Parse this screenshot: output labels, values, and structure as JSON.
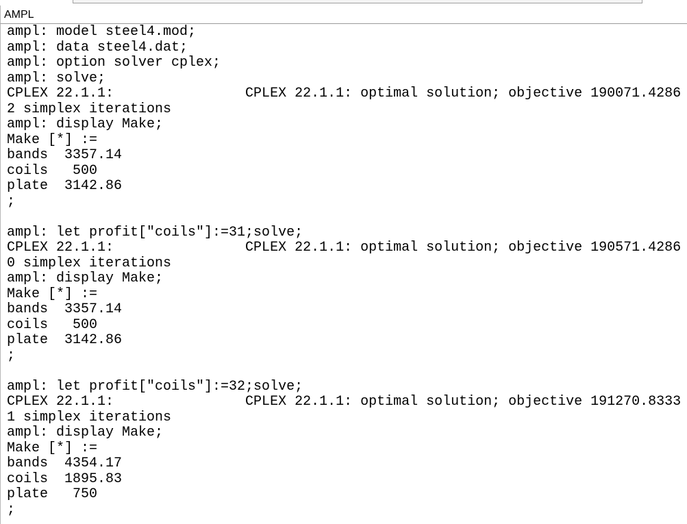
{
  "window": {
    "title": "AMPL"
  },
  "console": {
    "lines": [
      "ampl: model steel4.mod;",
      "ampl: data steel4.dat;",
      "ampl: option solver cplex;",
      "ampl: solve;",
      "CPLEX 22.1.1:                CPLEX 22.1.1: optimal solution; objective 190071.4286",
      "2 simplex iterations",
      "ampl: display Make;",
      "Make [*] :=",
      "bands  3357.14",
      "coils   500",
      "plate  3142.86",
      ";",
      "",
      "ampl: let profit[\"coils\"]:=31;solve;",
      "CPLEX 22.1.1:                CPLEX 22.1.1: optimal solution; objective 190571.4286",
      "0 simplex iterations",
      "ampl: display Make;",
      "Make [*] :=",
      "bands  3357.14",
      "coils   500",
      "plate  3142.86",
      ";",
      "",
      "ampl: let profit[\"coils\"]:=32;solve;",
      "CPLEX 22.1.1:                CPLEX 22.1.1: optimal solution; objective 191270.8333",
      "1 simplex iterations",
      "ampl: display Make;",
      "Make [*] :=",
      "bands  4354.17",
      "coils  1895.83",
      "plate   750",
      ";"
    ]
  }
}
